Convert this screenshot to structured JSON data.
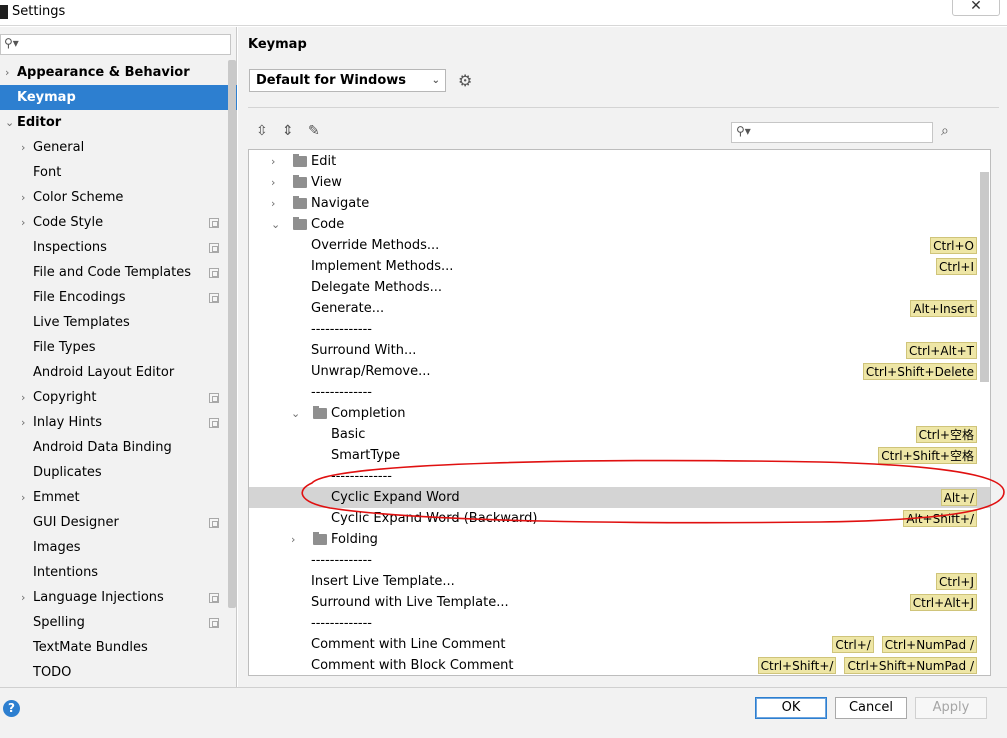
{
  "window": {
    "title": "Settings",
    "close_label": "✕"
  },
  "sidebar": {
    "items": [
      {
        "label": "Appearance & Behavior",
        "level": 0,
        "chevron": "›",
        "bold": true
      },
      {
        "label": "Keymap",
        "level": 0,
        "chevron": "",
        "bold": true,
        "selected": true
      },
      {
        "label": "Editor",
        "level": 0,
        "chevron": "⌄",
        "bold": true
      },
      {
        "label": "General",
        "level": 1,
        "chevron": "›"
      },
      {
        "label": "Font",
        "level": 1,
        "chevron": ""
      },
      {
        "label": "Color Scheme",
        "level": 1,
        "chevron": "›"
      },
      {
        "label": "Code Style",
        "level": 1,
        "chevron": "›",
        "project": true
      },
      {
        "label": "Inspections",
        "level": 1,
        "chevron": "",
        "project": true
      },
      {
        "label": "File and Code Templates",
        "level": 1,
        "chevron": "",
        "project": true
      },
      {
        "label": "File Encodings",
        "level": 1,
        "chevron": "",
        "project": true
      },
      {
        "label": "Live Templates",
        "level": 1,
        "chevron": ""
      },
      {
        "label": "File Types",
        "level": 1,
        "chevron": ""
      },
      {
        "label": "Android Layout Editor",
        "level": 1,
        "chevron": ""
      },
      {
        "label": "Copyright",
        "level": 1,
        "chevron": "›",
        "project": true
      },
      {
        "label": "Inlay Hints",
        "level": 1,
        "chevron": "›",
        "project": true
      },
      {
        "label": "Android Data Binding",
        "level": 1,
        "chevron": ""
      },
      {
        "label": "Duplicates",
        "level": 1,
        "chevron": ""
      },
      {
        "label": "Emmet",
        "level": 1,
        "chevron": "›"
      },
      {
        "label": "GUI Designer",
        "level": 1,
        "chevron": "",
        "project": true
      },
      {
        "label": "Images",
        "level": 1,
        "chevron": ""
      },
      {
        "label": "Intentions",
        "level": 1,
        "chevron": ""
      },
      {
        "label": "Language Injections",
        "level": 1,
        "chevron": "›",
        "project": true
      },
      {
        "label": "Spelling",
        "level": 1,
        "chevron": "",
        "project": true
      },
      {
        "label": "TextMate Bundles",
        "level": 1,
        "chevron": ""
      },
      {
        "label": "TODO",
        "level": 1,
        "chevron": ""
      }
    ]
  },
  "panel": {
    "breadcrumb": "Keymap",
    "keymap_selected": "Default for Windows",
    "tree": [
      {
        "label": "Edit",
        "level": 0,
        "chevron": "›",
        "folder": true,
        "shortcuts": []
      },
      {
        "label": "View",
        "level": 0,
        "chevron": "›",
        "folder": true,
        "shortcuts": []
      },
      {
        "label": "Navigate",
        "level": 0,
        "chevron": "›",
        "folder": true,
        "shortcuts": []
      },
      {
        "label": "Code",
        "level": 0,
        "chevron": "⌄",
        "folder": true,
        "shortcuts": []
      },
      {
        "label": "Override Methods...",
        "level": 1,
        "shortcuts": [
          "Ctrl+O"
        ]
      },
      {
        "label": "Implement Methods...",
        "level": 1,
        "shortcuts": [
          "Ctrl+I"
        ]
      },
      {
        "label": "Delegate Methods...",
        "level": 1,
        "shortcuts": []
      },
      {
        "label": "Generate...",
        "level": 1,
        "shortcuts": [
          "Alt+Insert"
        ]
      },
      {
        "label": "-------------",
        "level": 1,
        "shortcuts": []
      },
      {
        "label": "Surround With...",
        "level": 1,
        "shortcuts": [
          "Ctrl+Alt+T"
        ]
      },
      {
        "label": "Unwrap/Remove...",
        "level": 1,
        "shortcuts": [
          "Ctrl+Shift+Delete"
        ]
      },
      {
        "label": "-------------",
        "level": 1,
        "shortcuts": []
      },
      {
        "label": "Completion",
        "level": 1,
        "chevron": "⌄",
        "folder": true,
        "shortcuts": []
      },
      {
        "label": "Basic",
        "level": 2,
        "shortcuts": [
          "Ctrl+空格"
        ]
      },
      {
        "label": "SmartType",
        "level": 2,
        "shortcuts": [
          "Ctrl+Shift+空格"
        ]
      },
      {
        "label": "-------------",
        "level": 2,
        "shortcuts": []
      },
      {
        "label": "Cyclic Expand Word",
        "level": 2,
        "shortcuts": [
          "Alt+/"
        ],
        "selected": true
      },
      {
        "label": "Cyclic Expand Word (Backward)",
        "level": 2,
        "shortcuts": [
          "Alt+Shift+/"
        ]
      },
      {
        "label": "Folding",
        "level": 1,
        "chevron": "›",
        "folder": true,
        "shortcuts": []
      },
      {
        "label": "-------------",
        "level": 1,
        "shortcuts": []
      },
      {
        "label": "Insert Live Template...",
        "level": 1,
        "shortcuts": [
          "Ctrl+J"
        ]
      },
      {
        "label": "Surround with Live Template...",
        "level": 1,
        "shortcuts": [
          "Ctrl+Alt+J"
        ]
      },
      {
        "label": "-------------",
        "level": 1,
        "shortcuts": []
      },
      {
        "label": "Comment with Line Comment",
        "level": 1,
        "shortcuts": [
          "Ctrl+/",
          "Ctrl+NumPad /"
        ]
      },
      {
        "label": "Comment with Block Comment",
        "level": 1,
        "shortcuts": [
          "Ctrl+Shift+/",
          "Ctrl+Shift+NumPad /"
        ]
      }
    ]
  },
  "footer": {
    "ok": "OK",
    "cancel": "Cancel",
    "apply": "Apply",
    "help": "?"
  },
  "icons": {
    "search": "search-icon",
    "gear": "gear-icon",
    "expand_all": "expand-all-icon",
    "collapse_all": "collapse-all-icon",
    "edit": "pencil-icon",
    "find_shortcut": "find-by-shortcut-icon"
  },
  "colors": {
    "selection": "#2d7fd0",
    "shortcut_bg": "#eee6a6",
    "annotation": "#e01010"
  }
}
